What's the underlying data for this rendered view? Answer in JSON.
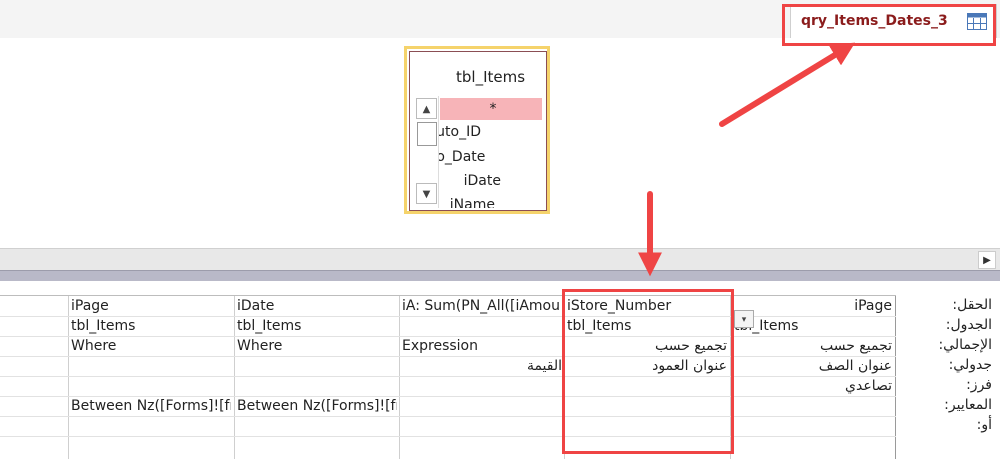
{
  "tab": {
    "title": "qry_Items_Dates_3",
    "icon": "query-design-icon"
  },
  "table_box": {
    "title": "tbl_Items",
    "fields": [
      "*",
      "Auto_ID",
      "uto_Date",
      "iDate",
      "iName"
    ]
  },
  "row_labels": [
    "الحقل:",
    "الجدول:",
    "الإجمالي:",
    "جدولي:",
    "فرز:",
    "المعايير:",
    "أو:"
  ],
  "columns": [
    {
      "field": "iPage",
      "table": "tbl_Items",
      "total": "تجميع حسب",
      "crosstab": "عنوان الصف",
      "sort": "تصاعدي",
      "criteria": "",
      "align": "right"
    },
    {
      "field": "iStore_Number",
      "table": "tbl_Items",
      "total": "تجميع حسب",
      "crosstab": "عنوان العمود",
      "sort": "",
      "criteria": "",
      "align": "mixed"
    },
    {
      "field": "iA: Sum(PN_All([iAmou",
      "table": "",
      "total": "Expression",
      "crosstab": "القيمة",
      "sort": "",
      "criteria": "",
      "align": "left"
    },
    {
      "field": "iDate",
      "table": "tbl_Items",
      "total": "Where",
      "crosstab": "",
      "sort": "",
      "criteria": "Between Nz([Forms]![fr",
      "align": "left"
    },
    {
      "field": "iPage",
      "table": "tbl_Items",
      "total": "Where",
      "crosstab": "",
      "sort": "",
      "criteria": "Between Nz([Forms]![fr",
      "align": "left"
    }
  ],
  "colors": {
    "highlight": "#ef4444",
    "table_border": "#f5d36b",
    "star_row": "#f7b4b8",
    "tab_title": "#8b1c1c"
  }
}
